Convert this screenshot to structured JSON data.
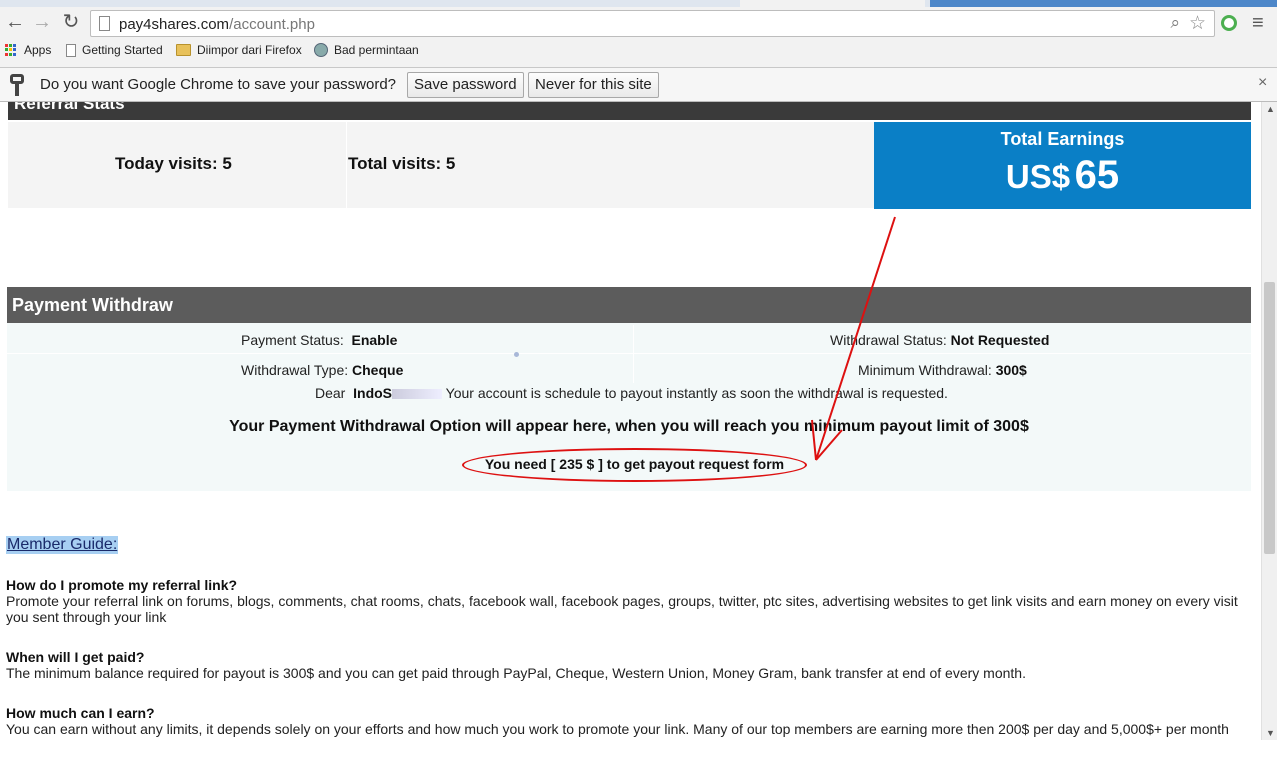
{
  "browser": {
    "url_host": "pay4shares.com",
    "url_path": "/account.php",
    "bookmarks": [
      "Apps",
      "Getting Started",
      "Diimpor dari Firefox",
      "Bad permintaan"
    ]
  },
  "infobar": {
    "message": "Do you want Google Chrome to save your password?",
    "save_label": "Save password",
    "never_label": "Never for this site",
    "close_glyph": "×"
  },
  "referral": {
    "header": "Referral Stats",
    "today_visits": "Today visits: 5",
    "total_visits": "Total visits: 5",
    "earnings_title": "Total Earnings",
    "earnings_currency": "US$",
    "earnings_value": "65"
  },
  "withdraw": {
    "header": "Payment Withdraw",
    "payment_status_label": "Payment Status:",
    "payment_status_value": "Enable",
    "withdrawal_status_label": "Withdrawal Status:",
    "withdrawal_status_value": "Not Requested",
    "withdrawal_type_label": "Withdrawal Type:",
    "withdrawal_type_value": "Cheque",
    "minimum_label": "Minimum Withdrawal:",
    "minimum_value": "300$",
    "dear_label": "Dear",
    "dear_name": "IndoS",
    "dear_message": "Your account is schedule to payout instantly as soon the withdrawal is requested.",
    "option_message": "Your Payment Withdrawal Option will appear here, when you will reach you minimum payout limit of 300$",
    "need_message": "You need [ 235 $ ] to get payout request form"
  },
  "guide": {
    "link": "Member Guide:",
    "faqs": [
      {
        "q": "How do I promote my referral link?",
        "a": "Promote your referral link on forums, blogs, comments, chat rooms, chats, facebook wall, facebook pages, groups, twitter, ptc sites, advertising websites to get link visits and earn money on every visit you sent through your link"
      },
      {
        "q": "When will I get paid?",
        "a": "The minimum balance required for payout is 300$ and you can get paid through PayPal, Cheque, Western Union, Money Gram, bank transfer at end of every month."
      },
      {
        "q": "How much can I earn?",
        "a": "You can earn without any limits, it depends solely on your efforts and how much you work to promote your link. Many of our top members are earning more then 200$ per day and 5,000$+ per month"
      }
    ]
  },
  "colors": {
    "earnings_bg": "#0a7fc6",
    "annotation_red": "#d11"
  },
  "icons": [
    "back-icon",
    "forward-icon",
    "reload-icon",
    "page-icon",
    "zoom-icon",
    "star-icon",
    "key-icon",
    "menu-icon"
  ]
}
